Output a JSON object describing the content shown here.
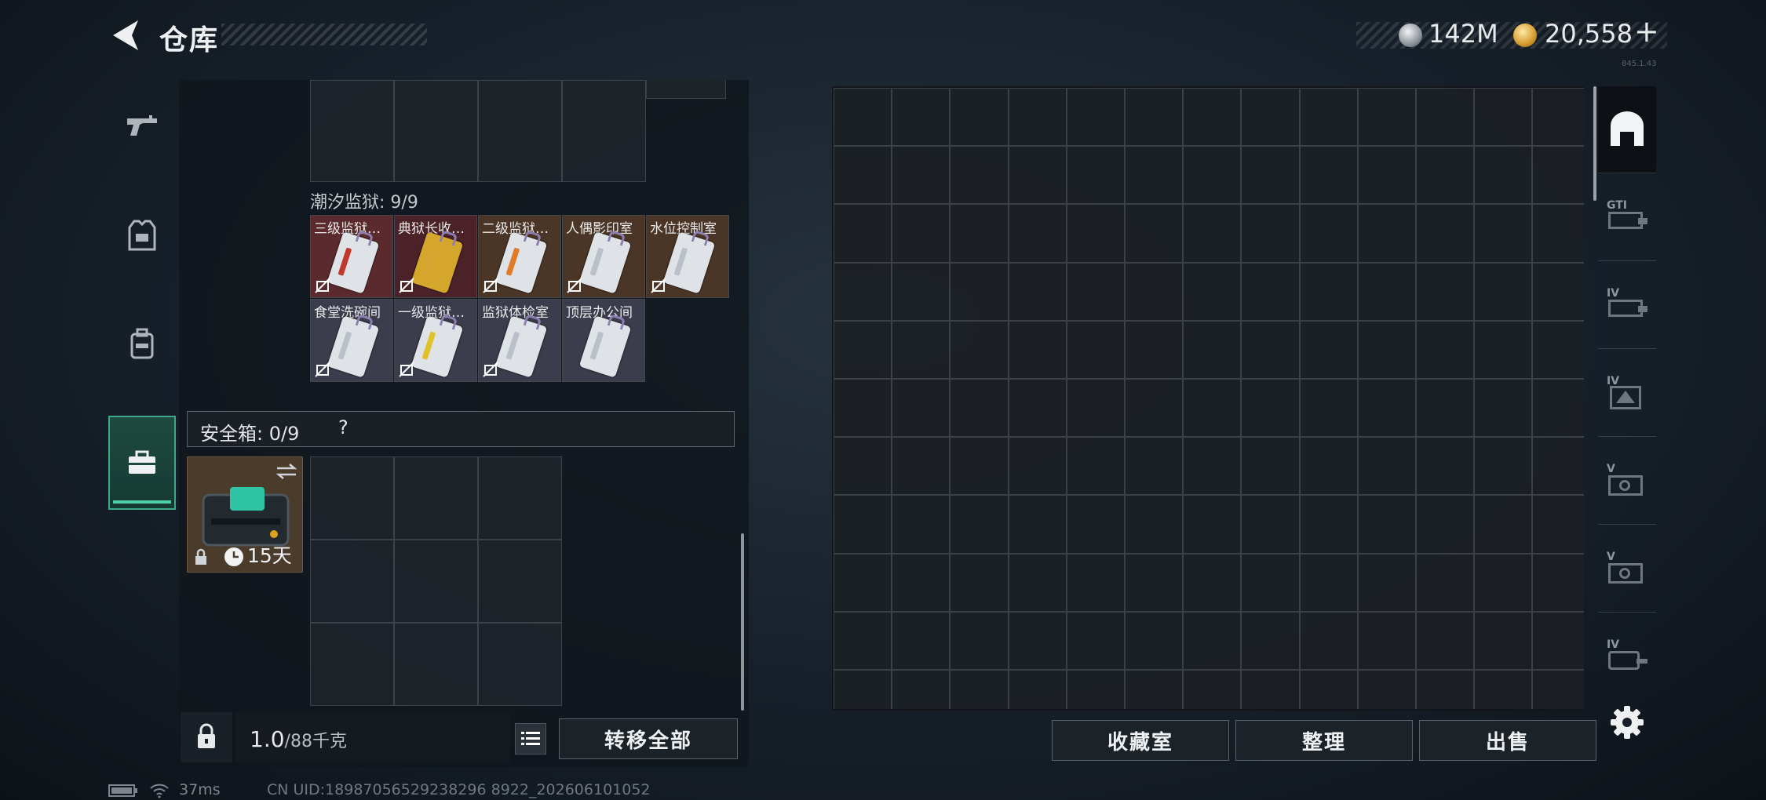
{
  "header": {
    "title": "仓库",
    "currencies": [
      {
        "icon": "silver-coin-icon",
        "value": "142M"
      },
      {
        "icon": "gold-coin-icon",
        "value": "20,558"
      }
    ],
    "add_label": "+",
    "version_text": "845.1.43"
  },
  "left_tabs": [
    {
      "icon": "gun-icon"
    },
    {
      "icon": "armor-icon"
    },
    {
      "icon": "backpack-icon"
    },
    {
      "icon": "toolbox-icon",
      "active": true
    }
  ],
  "inventory": {
    "prison_section_label": "潮汐监狱: 9/9",
    "keycards": [
      {
        "name": "三级监狱…",
        "bg": "#5a2a2e",
        "stripe": "#c0392b"
      },
      {
        "name": "典狱长收…",
        "bg": "#4a2228",
        "stripe": "#d6a531",
        "gold": true
      },
      {
        "name": "二级监狱…",
        "bg": "#4b3526",
        "stripe": "#e07b2a"
      },
      {
        "name": "人偶影印室",
        "bg": "#4b3526",
        "stripe": "#b9c0c9"
      },
      {
        "name": "水位控制室",
        "bg": "#4b3526",
        "stripe": "#b9c0c9"
      },
      {
        "name": "食堂洗碗间",
        "bg": "#3b3c4c",
        "stripe": "#b9c0c9"
      },
      {
        "name": "一级监狱…",
        "bg": "#3b3c4c",
        "stripe": "#e0c12a"
      },
      {
        "name": "监狱体检室",
        "bg": "#3b3c4c",
        "stripe": "#b9c0c9"
      },
      {
        "name": "顶层办公间",
        "bg": "#3b3c4c",
        "stripe": "#b9c0c9"
      }
    ],
    "safe_label": "安全箱: 0/9",
    "safe_help": "?",
    "safe_item": {
      "duration": "15天",
      "swap_icon": "swap-icon",
      "lock_icon": "lock-icon"
    }
  },
  "bottom_left": {
    "weight_current": "1.0",
    "weight_max": "/88千克",
    "transfer_all": "转移全部"
  },
  "bottom_right": {
    "collection": "收藏室",
    "organize": "整理",
    "sell": "出售"
  },
  "right_tabs": [
    {
      "icon": "warehouse-icon",
      "active": true
    },
    {
      "icon": "storage-tier-gti-icon",
      "label": "GTI"
    },
    {
      "icon": "storage-tier-iv-icon",
      "label": "IV"
    },
    {
      "icon": "storage-tier-iv-b-icon",
      "label": "IV"
    },
    {
      "icon": "storage-tier-v-icon",
      "label": "V"
    },
    {
      "icon": "storage-tier-v-b-icon",
      "label": "V"
    },
    {
      "icon": "storage-tier-iv-c-icon",
      "label": "IV"
    }
  ],
  "footer": {
    "ping": "37ms",
    "uid": "CN UID:18987056529238296 8922_202606101052"
  }
}
